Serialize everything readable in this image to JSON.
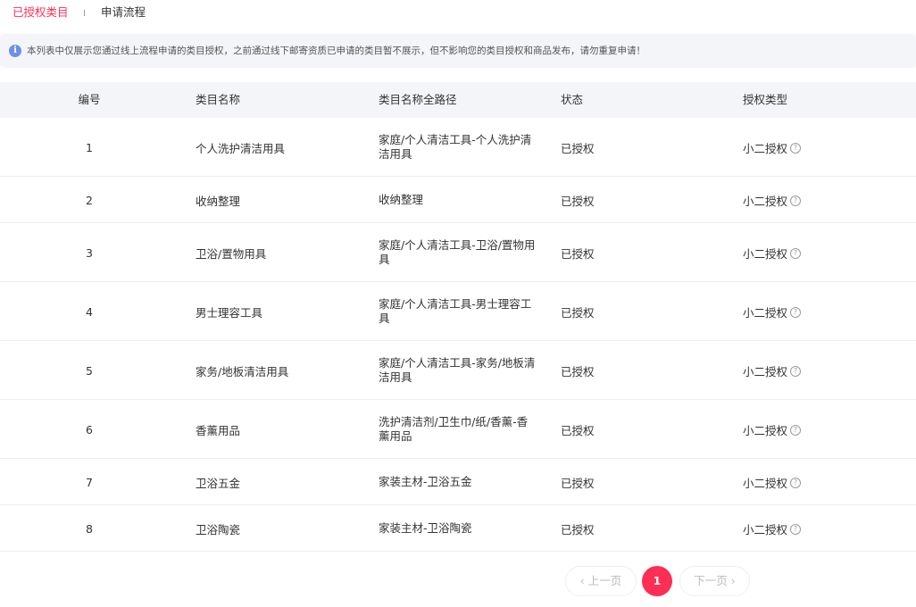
{
  "tabs": {
    "active": "已授权类目",
    "inactive": "申请流程"
  },
  "notice": {
    "icon": "info-icon",
    "text": "本列表中仅展示您通过线上流程申请的类目授权，之前通过线下邮寄资质已申请的类目暂不展示，但不影响您的类目授权和商品发布，请勿重复申请！"
  },
  "table": {
    "headers": [
      "编号",
      "类目名称",
      "类目名称全路径",
      "状态",
      "授权类型"
    ],
    "rows": [
      {
        "num": "1",
        "name": "个人洗护清洁用具",
        "path": "家庭/个人清洁工具-个人洗护清洁用具",
        "status": "已授权",
        "type": "小二授权"
      },
      {
        "num": "2",
        "name": "收纳整理",
        "path": "收纳整理",
        "status": "已授权",
        "type": "小二授权"
      },
      {
        "num": "3",
        "name": "卫浴/置物用具",
        "path": "家庭/个人清洁工具-卫浴/置物用具",
        "status": "已授权",
        "type": "小二授权"
      },
      {
        "num": "4",
        "name": "男士理容工具",
        "path": "家庭/个人清洁工具-男士理容工具",
        "status": "已授权",
        "type": "小二授权"
      },
      {
        "num": "5",
        "name": "家务/地板清洁用具",
        "path": "家庭/个人清洁工具-家务/地板清洁用具",
        "status": "已授权",
        "type": "小二授权"
      },
      {
        "num": "6",
        "name": "香薰用品",
        "path": "洗护清洁剂/卫生巾/纸/香薰-香薰用品",
        "status": "已授权",
        "type": "小二授权"
      },
      {
        "num": "7",
        "name": "卫浴五金",
        "path": "家装主材-卫浴五金",
        "status": "已授权",
        "type": "小二授权"
      },
      {
        "num": "8",
        "name": "卫浴陶瓷",
        "path": "家装主材-卫浴陶瓷",
        "status": "已授权",
        "type": "小二授权"
      }
    ]
  },
  "pagination": {
    "prev": "‹ 上一页",
    "current": "1",
    "next": "下一页 ›"
  },
  "colors": {
    "accent": "#ff2e54",
    "info": "#6d8fe8",
    "header_bg": "#f4f5f8"
  }
}
